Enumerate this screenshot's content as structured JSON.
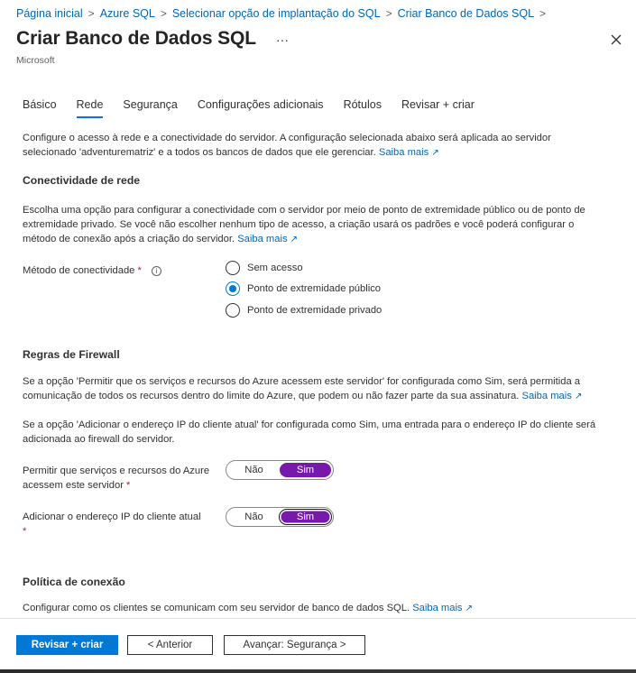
{
  "breadcrumb": [
    "Página inicial",
    "Azure SQL",
    "Selecionar opção de implantação do SQL",
    "Criar Banco de Dados SQL"
  ],
  "breadcrumb_separator": ">",
  "header": {
    "title": "Criar Banco de Dados SQL",
    "more": "···",
    "publisher": "Microsoft"
  },
  "tabs": [
    {
      "label": "Básico",
      "active": false
    },
    {
      "label": "Rede",
      "active": true
    },
    {
      "label": "Segurança",
      "active": false
    },
    {
      "label": "Configurações adicionais",
      "active": false
    },
    {
      "label": "Rótulos",
      "active": false
    },
    {
      "label": "Revisar + criar",
      "active": false
    }
  ],
  "intro": {
    "text": "Configure o acesso à rede e a conectividade do servidor. A configuração selecionada abaixo será aplicada ao servidor selecionado 'adventurematriz' e a todos os bancos de dados que ele gerenciar.",
    "link": "Saiba mais"
  },
  "network": {
    "heading": "Conectividade de rede",
    "desc": "Escolha uma opção para configurar a conectividade com o servidor por meio de ponto de extremidade público ou de ponto de extremidade privado. Se você não escolher nenhum tipo de acesso, a criação usará os padrões e você poderá configurar o método de conexão após a criação do servidor.",
    "link": "Saiba mais",
    "method_label": "Método de conectividade",
    "required": "*",
    "info": "i",
    "options": [
      {
        "label": "Sem acesso",
        "checked": false
      },
      {
        "label": "Ponto de extremidade público",
        "checked": true
      },
      {
        "label": "Ponto de extremidade privado",
        "checked": false
      }
    ]
  },
  "firewall": {
    "heading": "Regras de Firewall",
    "desc1": "Se a opção 'Permitir que os serviços e recursos do Azure acessem este servidor' for configurada como Sim, será permitida a comunicação de todos os recursos dentro do limite do Azure, que podem ou não fazer parte da sua assinatura.",
    "link": "Saiba mais",
    "desc2": "Se a opção 'Adicionar o endereço IP do cliente atual' for configurada como Sim, uma entrada para o endereço IP do cliente será adicionada ao firewall do servidor.",
    "allow_label_1": "Permitir que serviços e recursos do Azure",
    "allow_label_2": "acessem este servidor",
    "allow_value": "Sim",
    "add_ip_label": "Adicionar o endereço IP do cliente atual",
    "add_ip_value": "Sim",
    "no": "Não",
    "yes": "Sim"
  },
  "policy": {
    "heading": "Política de conexão",
    "desc": "Configurar como os clientes se comunicam com seu servidor de banco de dados SQL.",
    "link": "Saiba mais"
  },
  "footer": {
    "review": "Revisar + criar",
    "previous": "< Anterior",
    "next": "Avançar: Segurança >"
  },
  "colors": {
    "accent": "#0078d4",
    "link": "#0067b8",
    "toggle_on": "#7719aa",
    "required": "#a4262c"
  },
  "icons": {
    "external": "external-link-icon",
    "close": "close-icon",
    "info": "info-icon"
  }
}
